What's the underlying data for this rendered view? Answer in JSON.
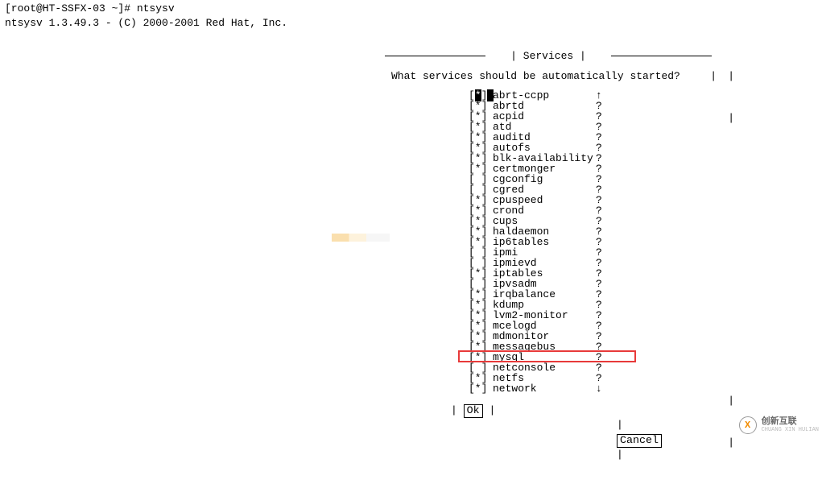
{
  "prompt": "[root@HT-SSFX-03 ~]# ntsysv",
  "version": "ntsysv 1.3.49.3 - (C) 2000-2001 Red Hat, Inc.",
  "dialog": {
    "title": "Services",
    "question": "What services should be automatically started?",
    "services": [
      {
        "checked": "*",
        "name": "abrt-ccpp",
        "scroll": "↑",
        "hl": true
      },
      {
        "checked": "*",
        "name": "abrtd",
        "scroll": "?"
      },
      {
        "checked": "*",
        "name": "acpid",
        "scroll": "?"
      },
      {
        "checked": "*",
        "name": "atd",
        "scroll": "?"
      },
      {
        "checked": "*",
        "name": "auditd",
        "scroll": "?"
      },
      {
        "checked": "*",
        "name": "autofs",
        "scroll": "?"
      },
      {
        "checked": "*",
        "name": "blk-availability",
        "scroll": "?"
      },
      {
        "checked": "*",
        "name": "certmonger",
        "scroll": "?"
      },
      {
        "checked": " ",
        "name": "cgconfig",
        "scroll": "?"
      },
      {
        "checked": " ",
        "name": "cgred",
        "scroll": "?"
      },
      {
        "checked": "*",
        "name": "cpuspeed",
        "scroll": "?"
      },
      {
        "checked": "*",
        "name": "crond",
        "scroll": "?"
      },
      {
        "checked": "*",
        "name": "cups",
        "scroll": "?"
      },
      {
        "checked": "*",
        "name": "haldaemon",
        "scroll": "?"
      },
      {
        "checked": "*",
        "name": "ip6tables",
        "scroll": "?"
      },
      {
        "checked": " ",
        "name": "ipmi",
        "scroll": "?"
      },
      {
        "checked": " ",
        "name": "ipmievd",
        "scroll": "?"
      },
      {
        "checked": "*",
        "name": "iptables",
        "scroll": "?"
      },
      {
        "checked": " ",
        "name": "ipvsadm",
        "scroll": "?"
      },
      {
        "checked": "*",
        "name": "irqbalance",
        "scroll": "?"
      },
      {
        "checked": "*",
        "name": "kdump",
        "scroll": "?"
      },
      {
        "checked": "*",
        "name": "lvm2-monitor",
        "scroll": "?"
      },
      {
        "checked": "*",
        "name": "mcelogd",
        "scroll": "?"
      },
      {
        "checked": "*",
        "name": "mdmonitor",
        "scroll": "?"
      },
      {
        "checked": "*",
        "name": "messagebus",
        "scroll": "?"
      },
      {
        "checked": "*",
        "name": "mysql",
        "scroll": "?",
        "boxed": true
      },
      {
        "checked": " ",
        "name": "netconsole",
        "scroll": "?"
      },
      {
        "checked": "*",
        "name": "netfs",
        "scroll": "?"
      },
      {
        "checked": "*",
        "name": "network",
        "scroll": "↓"
      }
    ],
    "ok": "Ok",
    "cancel": "Cancel"
  },
  "watermark": {
    "cn": "创新互联",
    "sub": "CHUANG XIN HULIAN"
  },
  "pipe": "|",
  "lb": "[",
  "rb": "]"
}
